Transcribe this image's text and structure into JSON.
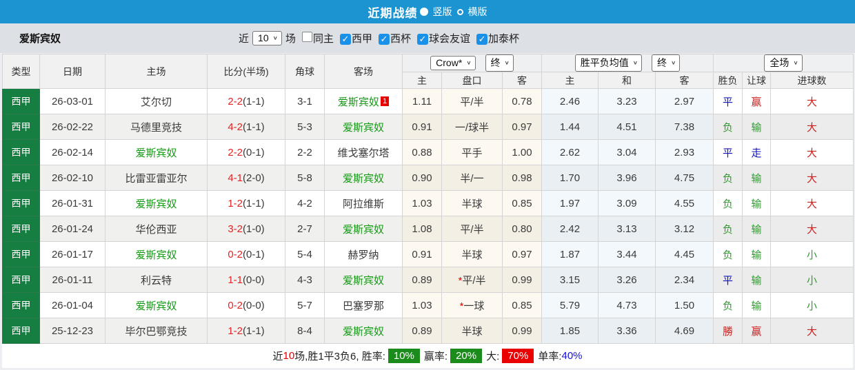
{
  "icons": {
    "chevron_down": "∨",
    "check": "✓"
  },
  "titlebar": {
    "title": "近期战绩",
    "vertical_label": "竖版",
    "horizontal_label": "横版"
  },
  "filterbar": {
    "team": "爱斯宾奴",
    "recent_label": "近",
    "recent_value": "10",
    "games_label": "场",
    "checkboxes": [
      {
        "label": "同主",
        "checked": false
      },
      {
        "label": "西甲",
        "checked": true
      },
      {
        "label": "西杯",
        "checked": true
      },
      {
        "label": "球会友谊",
        "checked": true
      },
      {
        "label": "加泰杯",
        "checked": true
      }
    ]
  },
  "table": {
    "static_headers": [
      "类型",
      "日期",
      "主场",
      "比分(半场)",
      "角球",
      "客场"
    ],
    "selects": {
      "odds_company": "Crow*",
      "odds_time": "终",
      "avg_name": "胜平负均值",
      "avg_time": "终",
      "scope": "全场"
    },
    "sub_headers": [
      "主",
      "盘口",
      "客",
      "主",
      "和",
      "客",
      "胜负",
      "让球",
      "进球数"
    ],
    "rows": [
      {
        "type": "西甲",
        "date": "26-03-01",
        "home": "艾尔切",
        "home_green": false,
        "score": "2-2",
        "half": "(1-1)",
        "corner": "3-1",
        "away": "爱斯宾奴",
        "away_green": true,
        "away_badge": "1",
        "odds_home": "1.11",
        "handicap_star": "",
        "handicap": "平/半",
        "odds_away": "0.78",
        "avg_win": "2.46",
        "avg_draw": "3.23",
        "avg_lose": "2.97",
        "result": "平",
        "result_c": "b",
        "let_result": "赢",
        "let_c": "r",
        "goal": "大",
        "goal_c": "r"
      },
      {
        "type": "西甲",
        "date": "26-02-22",
        "home": "马德里竞技",
        "home_green": false,
        "score": "4-2",
        "half": "(1-1)",
        "corner": "5-3",
        "away": "爱斯宾奴",
        "away_green": true,
        "away_badge": "",
        "odds_home": "0.91",
        "handicap_star": "",
        "handicap": "一/球半",
        "odds_away": "0.97",
        "avg_win": "1.44",
        "avg_draw": "4.51",
        "avg_lose": "7.38",
        "result": "负",
        "result_c": "g",
        "let_result": "输",
        "let_c": "g",
        "goal": "大",
        "goal_c": "r"
      },
      {
        "type": "西甲",
        "date": "26-02-14",
        "home": "爱斯宾奴",
        "home_green": true,
        "score": "2-2",
        "half": "(0-1)",
        "corner": "2-2",
        "away": "维戈塞尔塔",
        "away_green": false,
        "away_badge": "",
        "odds_home": "0.88",
        "handicap_star": "",
        "handicap": "平手",
        "odds_away": "1.00",
        "avg_win": "2.62",
        "avg_draw": "3.04",
        "avg_lose": "2.93",
        "result": "平",
        "result_c": "b",
        "let_result": "走",
        "let_c": "b",
        "goal": "大",
        "goal_c": "r"
      },
      {
        "type": "西甲",
        "date": "26-02-10",
        "home": "比雷亚雷亚尔",
        "home_green": false,
        "score": "4-1",
        "half": "(2-0)",
        "corner": "5-8",
        "away": "爱斯宾奴",
        "away_green": true,
        "away_badge": "",
        "odds_home": "0.90",
        "handicap_star": "",
        "handicap": "半/一",
        "odds_away": "0.98",
        "avg_win": "1.70",
        "avg_draw": "3.96",
        "avg_lose": "4.75",
        "result": "负",
        "result_c": "g",
        "let_result": "输",
        "let_c": "g",
        "goal": "大",
        "goal_c": "r"
      },
      {
        "type": "西甲",
        "date": "26-01-31",
        "home": "爱斯宾奴",
        "home_green": true,
        "score": "1-2",
        "half": "(1-1)",
        "corner": "4-2",
        "away": "阿拉维斯",
        "away_green": false,
        "away_badge": "",
        "odds_home": "1.03",
        "handicap_star": "",
        "handicap": "半球",
        "odds_away": "0.85",
        "avg_win": "1.97",
        "avg_draw": "3.09",
        "avg_lose": "4.55",
        "result": "负",
        "result_c": "g",
        "let_result": "输",
        "let_c": "g",
        "goal": "大",
        "goal_c": "r"
      },
      {
        "type": "西甲",
        "date": "26-01-24",
        "home": "华伦西亚",
        "home_green": false,
        "score": "3-2",
        "half": "(1-0)",
        "corner": "2-7",
        "away": "爱斯宾奴",
        "away_green": true,
        "away_badge": "",
        "odds_home": "1.08",
        "handicap_star": "",
        "handicap": "平/半",
        "odds_away": "0.80",
        "avg_win": "2.42",
        "avg_draw": "3.13",
        "avg_lose": "3.12",
        "result": "负",
        "result_c": "g",
        "let_result": "输",
        "let_c": "g",
        "goal": "大",
        "goal_c": "r"
      },
      {
        "type": "西甲",
        "date": "26-01-17",
        "home": "爱斯宾奴",
        "home_green": true,
        "score": "0-2",
        "half": "(0-1)",
        "corner": "5-4",
        "away": "赫罗纳",
        "away_green": false,
        "away_badge": "",
        "odds_home": "0.91",
        "handicap_star": "",
        "handicap": "半球",
        "odds_away": "0.97",
        "avg_win": "1.87",
        "avg_draw": "3.44",
        "avg_lose": "4.45",
        "result": "负",
        "result_c": "g",
        "let_result": "输",
        "let_c": "g",
        "goal": "小",
        "goal_c": "g"
      },
      {
        "type": "西甲",
        "date": "26-01-11",
        "home": "利云特",
        "home_green": false,
        "score": "1-1",
        "half": "(0-0)",
        "corner": "4-3",
        "away": "爱斯宾奴",
        "away_green": true,
        "away_badge": "",
        "odds_home": "0.89",
        "handicap_star": "*",
        "handicap": "平/半",
        "odds_away": "0.99",
        "avg_win": "3.15",
        "avg_draw": "3.26",
        "avg_lose": "2.34",
        "result": "平",
        "result_c": "b",
        "let_result": "输",
        "let_c": "g",
        "goal": "小",
        "goal_c": "g"
      },
      {
        "type": "西甲",
        "date": "26-01-04",
        "home": "爱斯宾奴",
        "home_green": true,
        "score": "0-2",
        "half": "(0-0)",
        "corner": "5-7",
        "away": "巴塞罗那",
        "away_green": false,
        "away_badge": "",
        "odds_home": "1.03",
        "handicap_star": "*",
        "handicap": "一球",
        "odds_away": "0.85",
        "avg_win": "5.79",
        "avg_draw": "4.73",
        "avg_lose": "1.50",
        "result": "负",
        "result_c": "g",
        "let_result": "输",
        "let_c": "g",
        "goal": "小",
        "goal_c": "g"
      },
      {
        "type": "西甲",
        "date": "25-12-23",
        "home": "毕尔巴鄂竞技",
        "home_green": false,
        "score": "1-2",
        "half": "(1-1)",
        "corner": "8-4",
        "away": "爱斯宾奴",
        "away_green": true,
        "away_badge": "",
        "odds_home": "0.89",
        "handicap_star": "",
        "handicap": "半球",
        "odds_away": "0.99",
        "avg_win": "1.85",
        "avg_draw": "3.36",
        "avg_lose": "4.69",
        "result": "勝",
        "result_c": "r",
        "let_result": "赢",
        "let_c": "r",
        "goal": "大",
        "goal_c": "r"
      }
    ]
  },
  "footer": {
    "prefix": "近",
    "count": "10",
    "summary_rest": "场,胜1平3负6, 胜率:",
    "win_rate": "10%",
    "handicap_label": "赢率:",
    "handicap_rate": "20%",
    "big_label": "大:",
    "big_rate": "70%",
    "single_label": "单率:",
    "single_rate": "40%"
  },
  "colors": {
    "topbar_blue": "#1d94d2",
    "type_green": "#177e41",
    "team_green": "#149a14",
    "score_red": "#e62222",
    "badge_green": "#1b8c1b",
    "badge_red": "#ea0000",
    "single_blue": "#1414d6"
  }
}
